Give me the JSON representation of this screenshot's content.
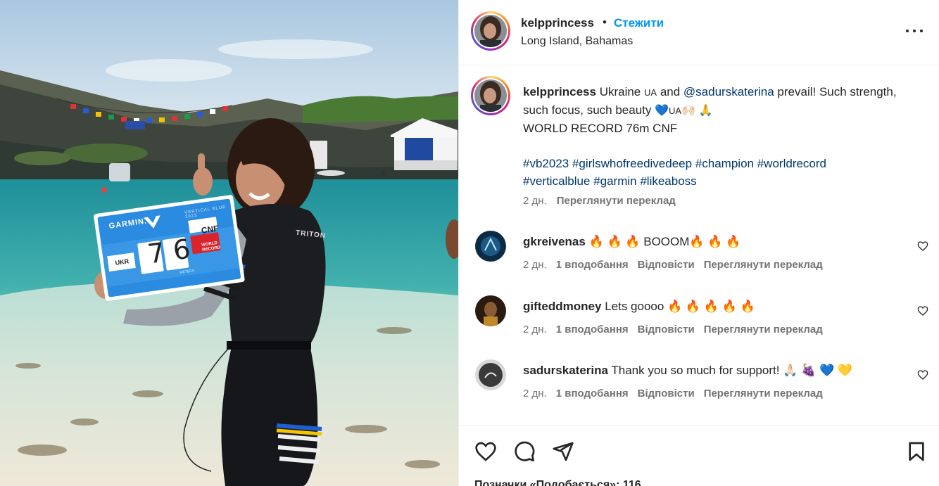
{
  "header": {
    "username": "kelpprincess",
    "dot": "•",
    "follow_label": "Стежити",
    "location": "Long Island, Bahamas"
  },
  "caption": {
    "username": "kelpprincess",
    "text_1": "Ukraine",
    "flag_1": "UA",
    "text_2": "and",
    "mention": "@sadurskaterina",
    "text_3": "prevail! Such strength, such focus, such beauty",
    "emoji_1": "💙",
    "flag_2": "UA",
    "emoji_2": "🙌🏻 🙏",
    "line_2": "WORLD RECORD 76m CNF",
    "hashtags": [
      "#vb2023",
      "#girlswhofreedivedeep",
      "#champion",
      "#worldrecord",
      "#verticalblue",
      "#garmin",
      "#likeaboss"
    ],
    "time": "2 дн.",
    "translate": "Переглянути переклад"
  },
  "comments": [
    {
      "username": "gkreivenas",
      "text": "🔥 🔥 🔥  BOOOM🔥 🔥 🔥",
      "time": "2 дн.",
      "likes": "1 вподобання",
      "reply": "Відповісти",
      "translate": "Переглянути переклад",
      "avatar_color": "#0d2a44"
    },
    {
      "username": "gifteddmoney",
      "text": "Lets goooo 🔥 🔥 🔥 🔥 🔥",
      "time": "2 дн.",
      "likes": "1 вподобання",
      "reply": "Відповісти",
      "translate": "Переглянути переклад",
      "avatar_color": "#2a1a10"
    },
    {
      "username": "sadurskaterina",
      "text": "Thank you so much for support! 🙏🏻 🍇 💙 💛",
      "time": "2 дн.",
      "likes": "1 вподобання",
      "reply": "Відповісти",
      "translate": "Переглянути переклад",
      "avatar_color": "#3a3a3a"
    }
  ],
  "photo_sign": {
    "brand": "GARMIN.",
    "event": "VERTICAL BLUE 2023",
    "country": "UKR",
    "digit_1": "7",
    "digit_2": "6",
    "discipline": "CNF",
    "record": "WORLD RECORD",
    "unit": "METERS"
  },
  "photo_wetsuit_label": "TRITON",
  "footer": {
    "likes_text": "Позначки «Подобається»: 116"
  },
  "icons": {
    "more": "more-horizontal-icon",
    "like": "heart-icon",
    "comment": "comment-icon",
    "share": "share-icon",
    "save": "bookmark-icon"
  },
  "colors": {
    "accent_blue": "#0095f6",
    "link_blue": "#00376b",
    "muted": "#737373",
    "text": "#262626"
  }
}
